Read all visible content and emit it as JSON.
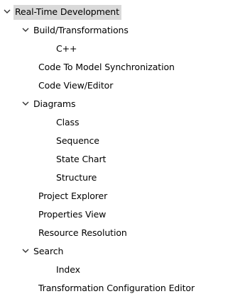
{
  "tree": {
    "selected_label": "Real-Time Development",
    "items": [
      {
        "label": "Real-Time Development",
        "depth": 0,
        "expanded": true,
        "icon": "chevron-down-icon"
      },
      {
        "label": "Build/Transformations",
        "depth": 1,
        "expanded": true,
        "icon": "chevron-down-icon"
      },
      {
        "label": "C++",
        "depth": 2
      },
      {
        "label": "Code To Model Synchronization",
        "depth": 1
      },
      {
        "label": "Code View/Editor",
        "depth": 1
      },
      {
        "label": "Diagrams",
        "depth": 1,
        "expanded": true,
        "icon": "chevron-down-icon"
      },
      {
        "label": "Class",
        "depth": 2
      },
      {
        "label": "Sequence",
        "depth": 2
      },
      {
        "label": "State Chart",
        "depth": 2
      },
      {
        "label": "Structure",
        "depth": 2
      },
      {
        "label": "Project Explorer",
        "depth": 1
      },
      {
        "label": "Properties View",
        "depth": 1
      },
      {
        "label": "Resource Resolution",
        "depth": 1
      },
      {
        "label": "Search",
        "depth": 1,
        "expanded": true,
        "icon": "chevron-down-icon"
      },
      {
        "label": "Index",
        "depth": 2
      },
      {
        "label": "Transformation Configuration Editor",
        "depth": 1
      }
    ]
  }
}
